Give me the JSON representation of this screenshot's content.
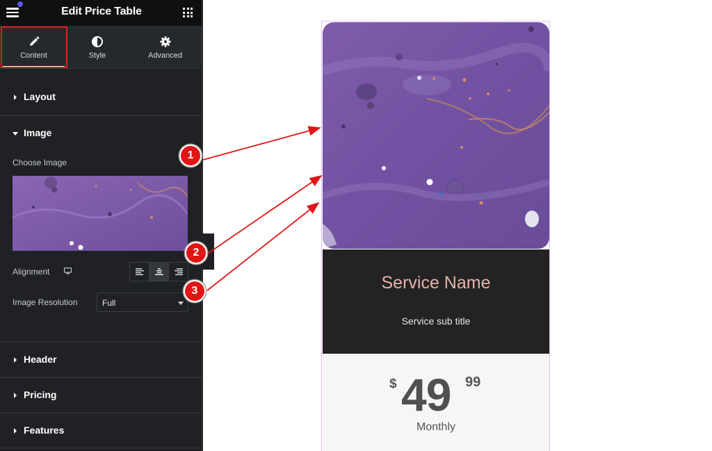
{
  "panel": {
    "title": "Edit Price Table",
    "tabs": [
      {
        "label": "Content",
        "icon": "pencil-icon",
        "active": true
      },
      {
        "label": "Style",
        "icon": "half-circle-icon",
        "active": false
      },
      {
        "label": "Advanced",
        "icon": "gear-icon",
        "active": false
      }
    ],
    "sections": {
      "layout": "Layout",
      "image": "Image",
      "header": "Header",
      "pricing": "Pricing",
      "features": "Features"
    },
    "image_section": {
      "choose_image_label": "Choose Image",
      "alignment_label": "Alignment",
      "alignment_options": [
        "left",
        "center",
        "right"
      ],
      "alignment_selected": "center",
      "resolution_label": "Image Resolution",
      "resolution_value": "Full"
    }
  },
  "preview": {
    "service_name": "Service Name",
    "service_subtitle": "Service sub title",
    "currency": "$",
    "price_integer": "49",
    "price_fraction": "99",
    "period": "Monthly"
  },
  "annotations": [
    "1",
    "2",
    "3"
  ],
  "colors": {
    "accent_highlight": "#e11d1d",
    "service_name": "#e9b2ad",
    "card_border": "#e4b9f2"
  }
}
